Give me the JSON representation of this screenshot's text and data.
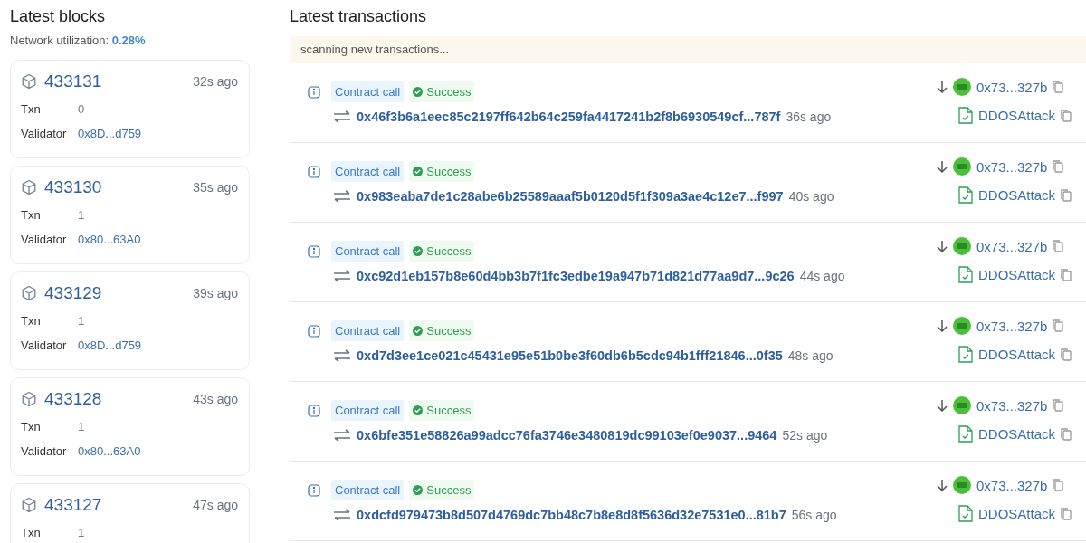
{
  "blocks": {
    "title": "Latest blocks",
    "utilization_label": "Network utilization:",
    "utilization_value": "0.28%",
    "items": [
      {
        "number": "433131",
        "age": "32s ago",
        "txn_label": "Txn",
        "txn": "0",
        "validator_label": "Validator",
        "validator": "0x8D...d759"
      },
      {
        "number": "433130",
        "age": "35s ago",
        "txn_label": "Txn",
        "txn": "1",
        "validator_label": "Validator",
        "validator": "0x80...63A0"
      },
      {
        "number": "433129",
        "age": "39s ago",
        "txn_label": "Txn",
        "txn": "1",
        "validator_label": "Validator",
        "validator": "0x8D...d759"
      },
      {
        "number": "433128",
        "age": "43s ago",
        "txn_label": "Txn",
        "txn": "1",
        "validator_label": "Validator",
        "validator": "0x80...63A0"
      },
      {
        "number": "433127",
        "age": "47s ago",
        "txn_label": "Txn",
        "txn": "1"
      }
    ]
  },
  "transactions": {
    "title": "Latest transactions",
    "notice": "scanning new transactions...",
    "items": [
      {
        "type": "Contract call",
        "status": "Success",
        "hash": "0x46f3b6a1eec85c2197ff642b64c259fa4417241b2f8b6930549cf...787f",
        "age": "36s ago",
        "from": "0x73...327b",
        "contract": "DDOSAttack"
      },
      {
        "type": "Contract call",
        "status": "Success",
        "hash": "0x983eaba7de1c28abe6b25589aaaf5b0120d5f1f309a3ae4c12e7...f997",
        "age": "40s ago",
        "from": "0x73...327b",
        "contract": "DDOSAttack"
      },
      {
        "type": "Contract call",
        "status": "Success",
        "hash": "0xc92d1eb157b8e60d4bb3b7f1fc3edbe19a947b71d821d77aa9d7...9c26",
        "age": "44s ago",
        "from": "0x73...327b",
        "contract": "DDOSAttack"
      },
      {
        "type": "Contract call",
        "status": "Success",
        "hash": "0xd7d3ee1ce021c45431e95e51b0be3f60db6b5cdc94b1fff21846...0f35",
        "age": "48s ago",
        "from": "0x73...327b",
        "contract": "DDOSAttack"
      },
      {
        "type": "Contract call",
        "status": "Success",
        "hash": "0x6bfe351e58826a99adcc76fa3746e3480819dc99103ef0e9037...9464",
        "age": "52s ago",
        "from": "0x73...327b",
        "contract": "DDOSAttack"
      },
      {
        "type": "Contract call",
        "status": "Success",
        "hash": "0xdcfd979473b8d507d4769dc7bb48c7b8e8d8f5636d32e7531e0...81b7",
        "age": "56s ago",
        "from": "0x73...327b",
        "contract": "DDOSAttack"
      }
    ]
  }
}
